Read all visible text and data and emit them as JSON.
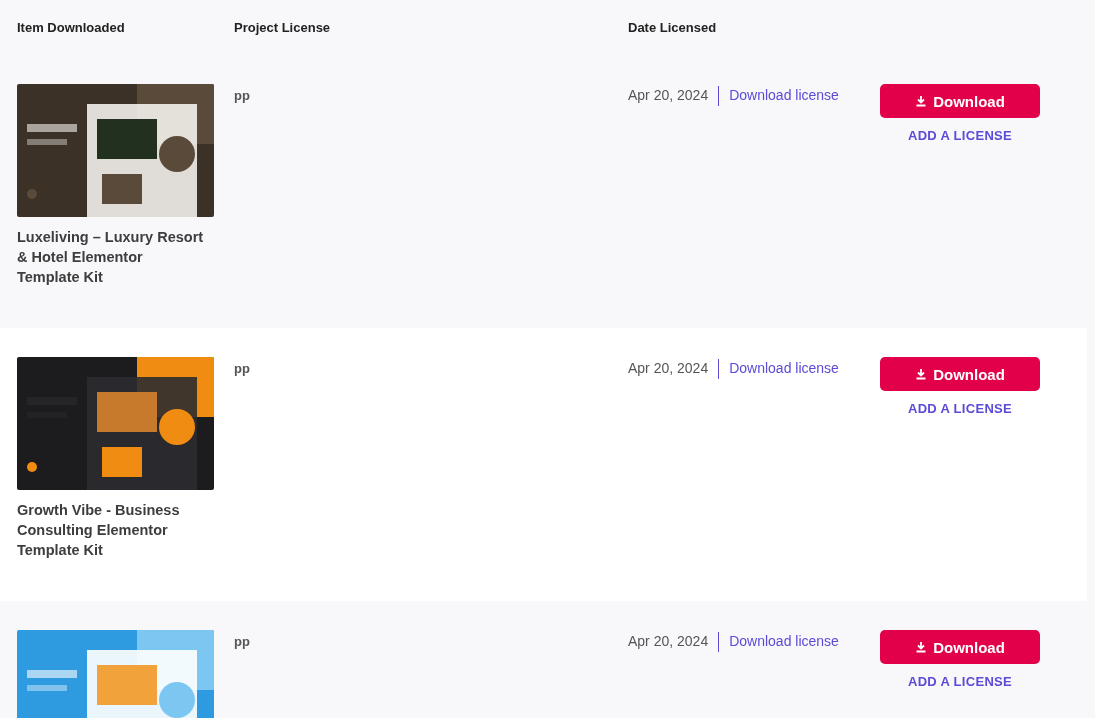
{
  "columns": [
    "Item Downloaded",
    "Project License",
    "Date Licensed"
  ],
  "rows": [
    {
      "title": "Luxeliving – Luxury Resort & Hotel Elementor Template Kit",
      "project": "pp",
      "date": "Apr 20, 2024",
      "license_link": "Download license",
      "download": "Download",
      "add_license": "ADD A LICENSE"
    },
    {
      "title": "Growth Vibe - Business Consulting Elementor Template Kit",
      "project": "pp",
      "date": "Apr 20, 2024",
      "license_link": "Download license",
      "download": "Download",
      "add_license": "ADD A LICENSE"
    },
    {
      "project": "pp",
      "date": "Apr 20, 2024",
      "license_link": "Download license",
      "download": "Download",
      "add_license": "ADD A LICENSE"
    }
  ]
}
